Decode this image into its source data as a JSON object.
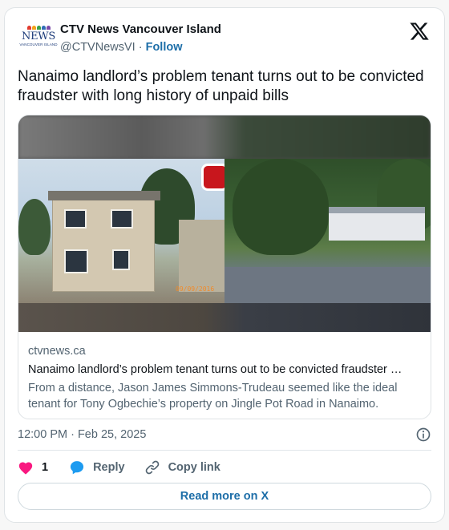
{
  "account": {
    "name": "CTV News Vancouver Island",
    "handle": "@CTVNewsVI",
    "separator": "·",
    "follow_label": "Follow",
    "logo_text": "NEWS",
    "logo_subtext": "VANCOUVER ISLAND"
  },
  "tweet": {
    "text": "Nanaimo landlord’s problem tenant turns out to be convicted fraudster with long history of unpaid bills"
  },
  "link_card": {
    "domain": "ctvnews.ca",
    "title": "Nanaimo landlord’s problem tenant turns out to be convicted fraudster …",
    "description": "From a distance, Jason James Simmons-Trudeau seemed like the ideal tenant for Tony Ogbechie’s property on Jingle Pot Road in Nanaimo.",
    "photo_date_stamp": "09/09/2016"
  },
  "meta": {
    "timestamp": "12:00 PM · Feb 25, 2025"
  },
  "actions": {
    "like_count": "1",
    "reply_label": "Reply",
    "copy_link_label": "Copy link"
  },
  "read_more_label": "Read more on X",
  "colors": {
    "like": "#f91880",
    "reply": "#1d9bf0",
    "link": "#1d6ea8",
    "secondary_text": "#536471",
    "primary_text": "#0f1419"
  },
  "icons": [
    "ctv-news-logo",
    "x-logo-icon",
    "info-icon",
    "heart-icon",
    "reply-bubble-icon",
    "link-icon"
  ]
}
